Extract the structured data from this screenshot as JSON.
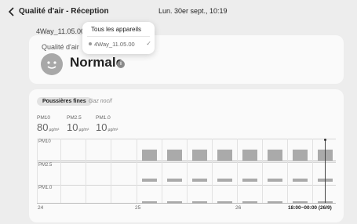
{
  "header": {
    "title": "Qualité d'air - Réception",
    "datetime": "Lun. 30er sept., 10:19"
  },
  "device": {
    "name": "4Way_11.05.00"
  },
  "dropdown": {
    "title": "Tous les appareils",
    "item": "4Way_11.05.00",
    "check": "✓"
  },
  "quality": {
    "label": "Qualité d'air",
    "status": "Normale",
    "info": "i"
  },
  "tabs": {
    "active": "Poussières fines",
    "inactive": "Gaz nocif"
  },
  "readings": [
    {
      "label": "PM10",
      "value": "80",
      "unit": "µg/m³"
    },
    {
      "label": "PM2.5",
      "value": "10",
      "unit": "µg/m³"
    },
    {
      "label": "PM1.0",
      "value": "10",
      "unit": "µg/m³"
    }
  ],
  "chart_data": {
    "type": "bar",
    "rows": [
      "PM10",
      "PM2.5",
      "PM1.0"
    ],
    "bar_count": 8,
    "x_labels": [
      "24",
      "25",
      "26",
      "18:00~00:00 (26/9)"
    ],
    "bar_color": "#aaaaaa"
  }
}
